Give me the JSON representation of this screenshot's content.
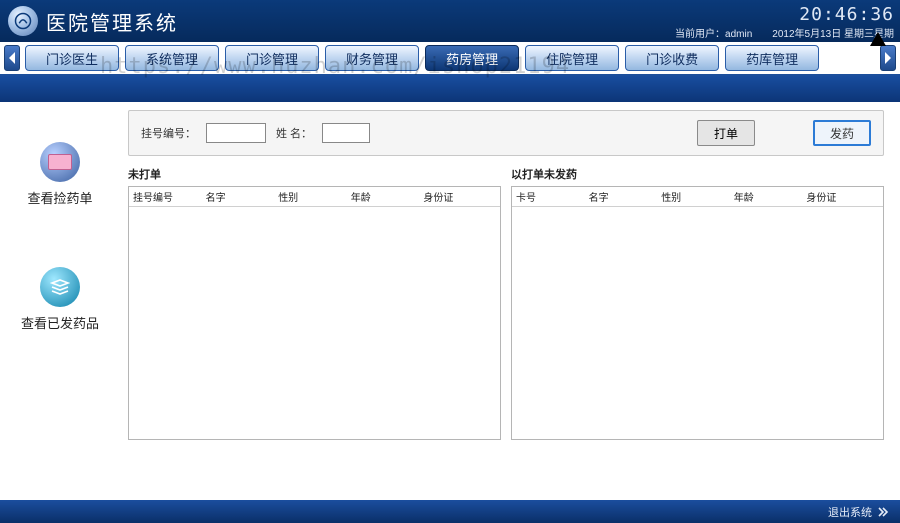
{
  "header": {
    "title": "医院管理系统",
    "clock": "20:46:36",
    "user_label": "当前用户：",
    "user": "admin",
    "date": "2012年5月13日 星期三星期"
  },
  "tabs": [
    {
      "label": "门诊医生"
    },
    {
      "label": "系统管理"
    },
    {
      "label": "门诊管理"
    },
    {
      "label": "财务管理"
    },
    {
      "label": "药房管理",
      "active": true
    },
    {
      "label": "住院管理"
    },
    {
      "label": "门诊收费"
    },
    {
      "label": "药库管理"
    }
  ],
  "sidebar": {
    "items": [
      {
        "label": "查看捡药单",
        "icon": "pink"
      },
      {
        "label": "查看已发药品",
        "icon": "teal"
      }
    ]
  },
  "form": {
    "reg_label": "挂号编号：",
    "reg_value": "",
    "name_label": "姓 名：",
    "name_value": "",
    "btn_print": "打单",
    "btn_dispense": "发药"
  },
  "left_panel": {
    "caption": "未打单",
    "cols": [
      "挂号编号",
      "名字",
      "性别",
      "年龄",
      "身份证"
    ]
  },
  "right_panel": {
    "caption": "以打单未发药",
    "cols": [
      "卡号",
      "名字",
      "性别",
      "年龄",
      "身份证"
    ]
  },
  "footer": {
    "exit_label": "退出系统"
  },
  "watermark": "https://www.huzhan.com/ishop21194"
}
